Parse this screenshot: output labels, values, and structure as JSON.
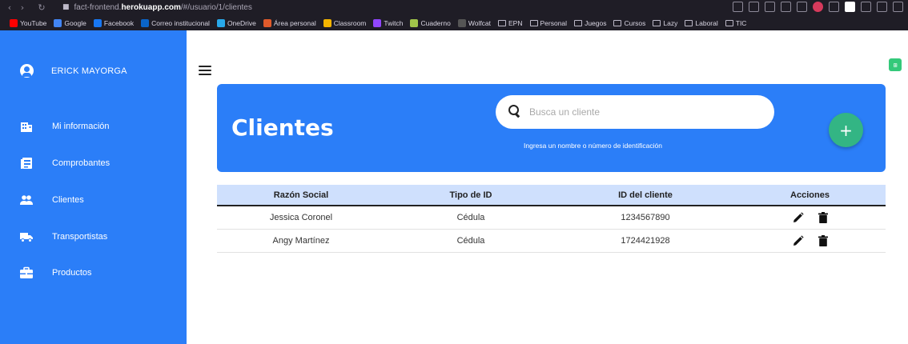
{
  "browser": {
    "url_prefix": "fact-frontend.",
    "url_domain": "herokuapp.com",
    "url_path": "/#/usuario/1/clientes",
    "bookmarks": [
      {
        "label": "YouTube",
        "icon": "youtube-icon",
        "color": "#ff0000"
      },
      {
        "label": "Google",
        "icon": "google-icon",
        "color": "#4285f4"
      },
      {
        "label": "Facebook",
        "icon": "facebook-icon",
        "color": "#1877f2"
      },
      {
        "label": "Correo institucional",
        "icon": "outlook-icon",
        "color": "#0a64c8"
      },
      {
        "label": "OneDrive",
        "icon": "onedrive-icon",
        "color": "#28a8ea"
      },
      {
        "label": "Área personal",
        "icon": "moodle-icon",
        "color": "#e05a2b"
      },
      {
        "label": "Classroom",
        "icon": "classroom-icon",
        "color": "#f4b400"
      },
      {
        "label": "Twitch",
        "icon": "twitch-icon",
        "color": "#9146ff"
      },
      {
        "label": "Cuaderno",
        "icon": "notebook-icon",
        "color": "#a0c44a"
      },
      {
        "label": "Wolfcat",
        "icon": "wolfcat-icon",
        "color": "#555555"
      },
      {
        "label": "EPN",
        "icon": "folder-icon",
        "color": ""
      },
      {
        "label": "Personal",
        "icon": "folder-icon",
        "color": ""
      },
      {
        "label": "Juegos",
        "icon": "folder-icon",
        "color": ""
      },
      {
        "label": "Cursos",
        "icon": "folder-icon",
        "color": ""
      },
      {
        "label": "Lazy",
        "icon": "folder-icon",
        "color": ""
      },
      {
        "label": "Laboral",
        "icon": "folder-icon",
        "color": ""
      },
      {
        "label": "TIC",
        "icon": "folder-icon",
        "color": ""
      }
    ]
  },
  "sidebar": {
    "user_name": "ERICK MAYORGA",
    "items": [
      {
        "label": "Mi información",
        "icon": "building-icon"
      },
      {
        "label": "Comprobantes",
        "icon": "document-list-icon"
      },
      {
        "label": "Clientes",
        "icon": "people-icon"
      },
      {
        "label": "Transportistas",
        "icon": "truck-icon"
      },
      {
        "label": "Productos",
        "icon": "toolbox-icon"
      }
    ]
  },
  "banner": {
    "title": "Clientes",
    "search_placeholder": "Busca un cliente",
    "search_hint": "Ingresa un nombre o número de identificación",
    "add_label": "+"
  },
  "table": {
    "headers": [
      "Razón Social",
      "Tipo de ID",
      "ID del cliente",
      "Acciones"
    ],
    "rows": [
      {
        "name": "Jessica Coronel",
        "id_type": "Cédula",
        "id": "1234567890"
      },
      {
        "name": "Angy Martínez",
        "id_type": "Cédula",
        "id": "1724421928"
      }
    ]
  },
  "colors": {
    "primary": "#2b7ef8",
    "accent": "#33b584",
    "header_bg": "#cfe0fd"
  }
}
